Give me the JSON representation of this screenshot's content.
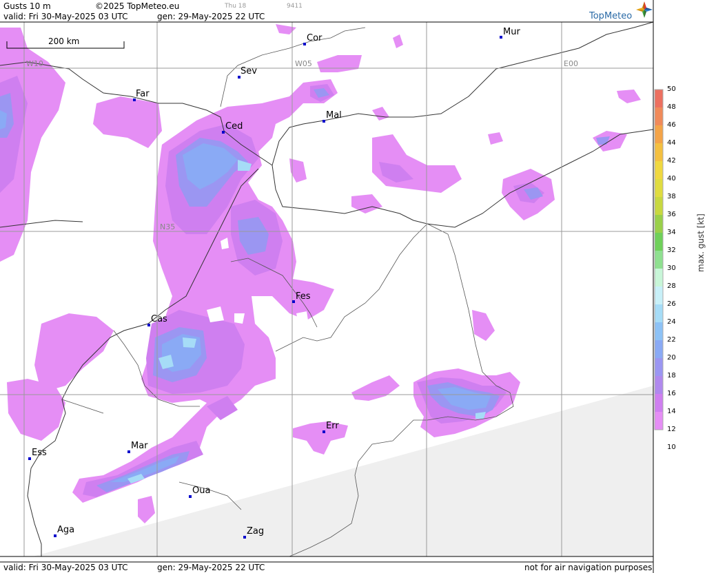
{
  "header": {
    "product": "Gusts 10 m",
    "copyright": "©2025 TopMeteo.eu",
    "day_small": "Thu 18",
    "code_small": "9411",
    "valid": "valid:  Fri  30-May-2025  03 UTC",
    "gen": "gen: 29-May-2025 22 UTC"
  },
  "footer": {
    "valid": "valid:  Fri  30-May-2025  03 UTC",
    "gen": "gen: 29-May-2025 22 UTC",
    "disclaimer": "not for air navigation purposes"
  },
  "brand": {
    "name": "TopMeteo",
    "colors": [
      "#e03030",
      "#f0b020",
      "#3080d0",
      "#40a040"
    ]
  },
  "scale": {
    "label": "200 km"
  },
  "grid": {
    "lon_labels": [
      "W10",
      "W05",
      "E00"
    ],
    "lat_labels": [
      "N35"
    ]
  },
  "cities": [
    {
      "name": "Cor"
    },
    {
      "name": "Mur"
    },
    {
      "name": "Sev"
    },
    {
      "name": "Far"
    },
    {
      "name": "Mal"
    },
    {
      "name": "Ced"
    },
    {
      "name": "Fes"
    },
    {
      "name": "Cas"
    },
    {
      "name": "Err"
    },
    {
      "name": "Ess"
    },
    {
      "name": "Mar"
    },
    {
      "name": "Oua"
    },
    {
      "name": "Aga"
    },
    {
      "name": "Zag"
    }
  ],
  "legend": {
    "title": "max. gust [kt]",
    "ticks": [
      "50",
      "48",
      "46",
      "44",
      "42",
      "40",
      "38",
      "36",
      "34",
      "32",
      "30",
      "28",
      "26",
      "24",
      "22",
      "20",
      "18",
      "16",
      "14",
      "12",
      "10"
    ],
    "colors": {
      "12-14": "#e58ef5",
      "14-16": "#cf7ff0",
      "16-18": "#b089ee",
      "18-20": "#9b96f2",
      "20-22": "#8aaaf5",
      "22-24": "#8dc2f6",
      "24-26": "#a6dcf7",
      "26-28": "#c8f0f8",
      "28-30": "#c8f6d8",
      "30-32": "#8fe090",
      "32-34": "#6fd05a",
      "34-36": "#9ad04a",
      "36-38": "#c8d840",
      "38-40": "#e0dc40",
      "40-42": "#f0d840",
      "42-44": "#f4c040",
      "44-46": "#f4a448",
      "46-48": "#f08a5a",
      "48-50": "#ec7060"
    }
  }
}
